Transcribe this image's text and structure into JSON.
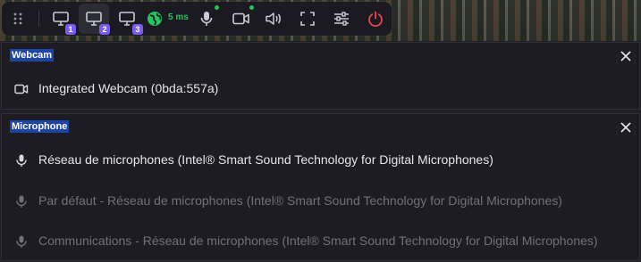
{
  "toolbar": {
    "display_badges": [
      "1",
      "2",
      "3"
    ],
    "ping": "5 ms"
  },
  "webcam": {
    "title": "Webcam",
    "device": "Integrated Webcam (0bda:557a)"
  },
  "microphone": {
    "title": "Microphone",
    "devices": [
      "Réseau de microphones (Intel® Smart Sound Technology for Digital Microphones)",
      "Par défaut - Réseau de microphones (Intel® Smart Sound Technology for Digital Microphones)",
      "Communications - Réseau de microphones (Intel® Smart Sound Technology for Digital Microphones)"
    ],
    "selected_index": 0
  },
  "colors": {
    "accent": "#7c5cf0",
    "status_green": "#22c55e",
    "power_red": "#e5484d",
    "title_highlight": "#1e44a8"
  }
}
